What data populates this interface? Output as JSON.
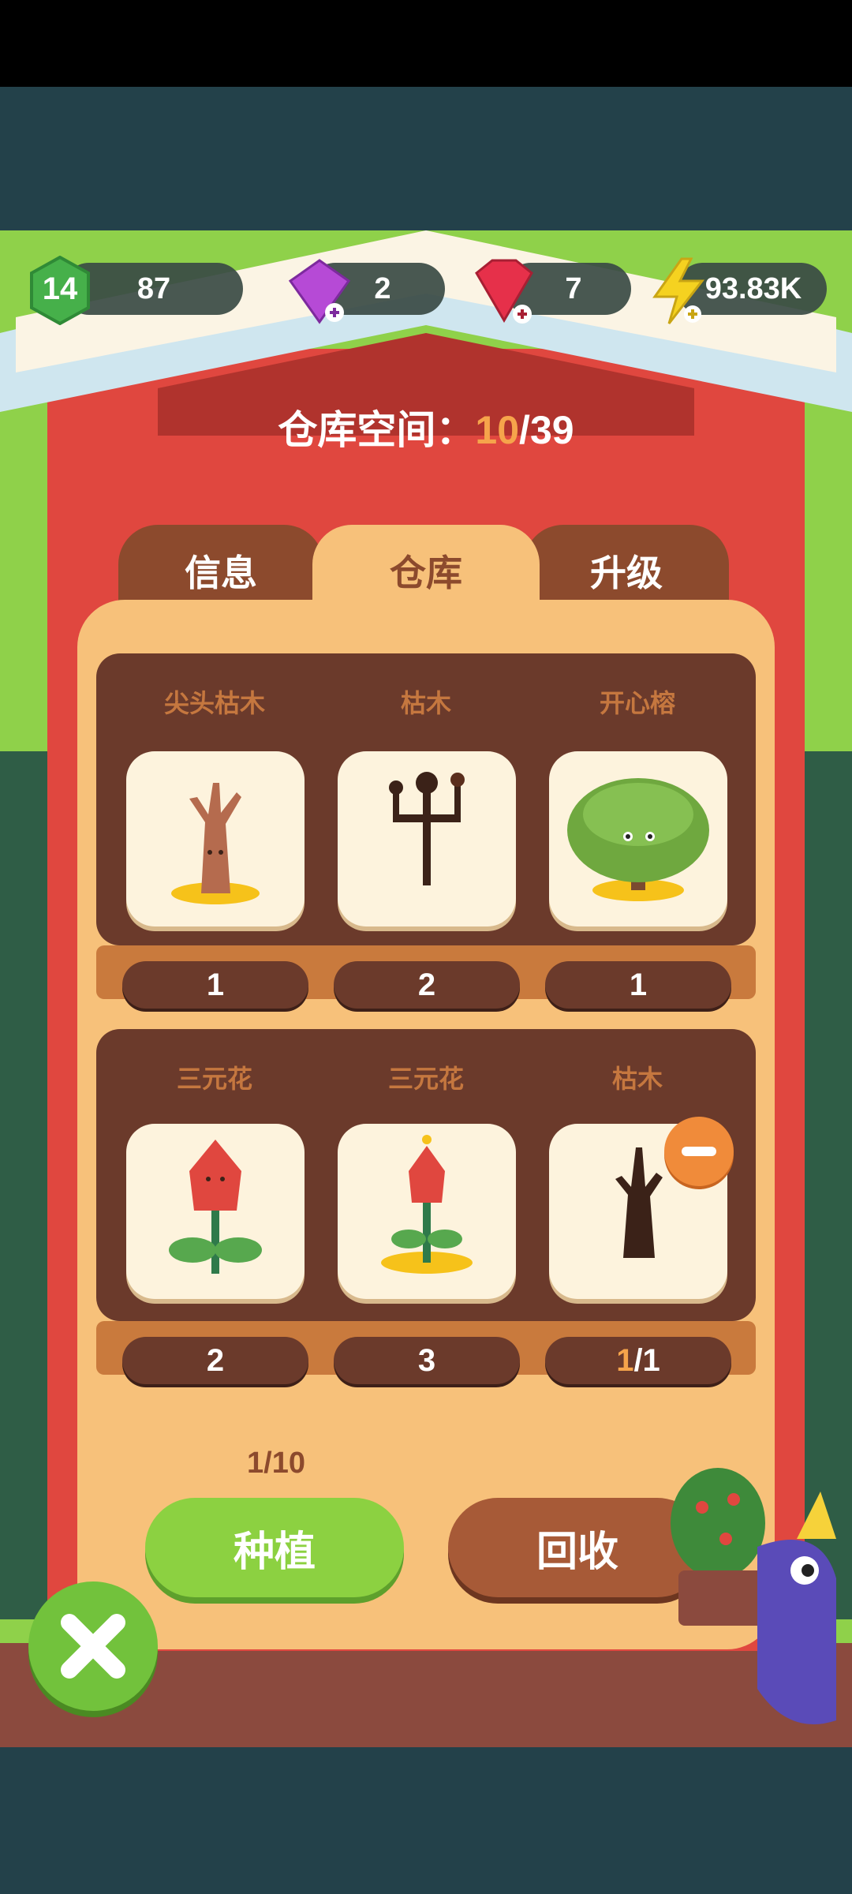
{
  "hud": {
    "level": "14",
    "xp": "87",
    "purple_gems": "2",
    "red_gems": "7",
    "energy": "93.83K"
  },
  "storage": {
    "label": "仓库空间：",
    "current": "10",
    "max": "/39"
  },
  "tabs": [
    {
      "label": "信息"
    },
    {
      "label": "仓库"
    },
    {
      "label": "升级"
    }
  ],
  "shelf1": {
    "items": [
      {
        "name": "尖头枯木",
        "count": "1",
        "icon": "dead-tree-spiky-icon"
      },
      {
        "name": "枯木",
        "count": "2",
        "icon": "dead-tree-icon"
      },
      {
        "name": "开心榕",
        "count": "1",
        "icon": "happy-banyan-icon"
      }
    ]
  },
  "shelf2": {
    "items": [
      {
        "name": "三元花",
        "count": "2",
        "icon": "flower-icon"
      },
      {
        "name": "三元花",
        "count": "3",
        "icon": "flower-icon"
      },
      {
        "name": "枯木",
        "count_hl": "1",
        "count_rest": "/1",
        "icon": "dead-tree-icon"
      }
    ]
  },
  "page": "1/10",
  "buttons": {
    "plant": "种植",
    "recycle": "回收"
  },
  "colors": {
    "house_red": "#e0473f",
    "panel": "#f7c17a",
    "highlight": "#f6a44b"
  }
}
